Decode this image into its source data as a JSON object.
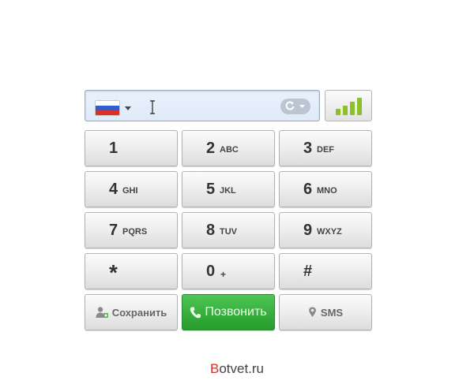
{
  "dialer": {
    "phone_input": {
      "value": "",
      "placeholder": ""
    },
    "country_flag": "russia-flag",
    "signal_colors": [
      "#8cbf2a",
      "#8cbf2a",
      "#8cbf2a",
      "#8cbf2a"
    ],
    "keys": [
      {
        "digit": "1",
        "letters": ""
      },
      {
        "digit": "2",
        "letters": "ABC"
      },
      {
        "digit": "3",
        "letters": "DEF"
      },
      {
        "digit": "4",
        "letters": "GHI"
      },
      {
        "digit": "5",
        "letters": "JKL"
      },
      {
        "digit": "6",
        "letters": "MNO"
      },
      {
        "digit": "7",
        "letters": "PQRS"
      },
      {
        "digit": "8",
        "letters": "TUV"
      },
      {
        "digit": "9",
        "letters": "WXYZ"
      },
      {
        "digit": "*",
        "letters": ""
      },
      {
        "digit": "0",
        "letters": "+"
      },
      {
        "digit": "#",
        "letters": ""
      }
    ],
    "actions": {
      "save_label": "Сохранить",
      "call_label": "Позвонить",
      "sms_label": "SMS"
    },
    "colors": {
      "call_green": "#36ae3c",
      "flag_blue": "#2f5fcf",
      "flag_red": "#d8322a"
    }
  },
  "watermark": {
    "first_letter": "B",
    "rest": "otvet.ru"
  }
}
